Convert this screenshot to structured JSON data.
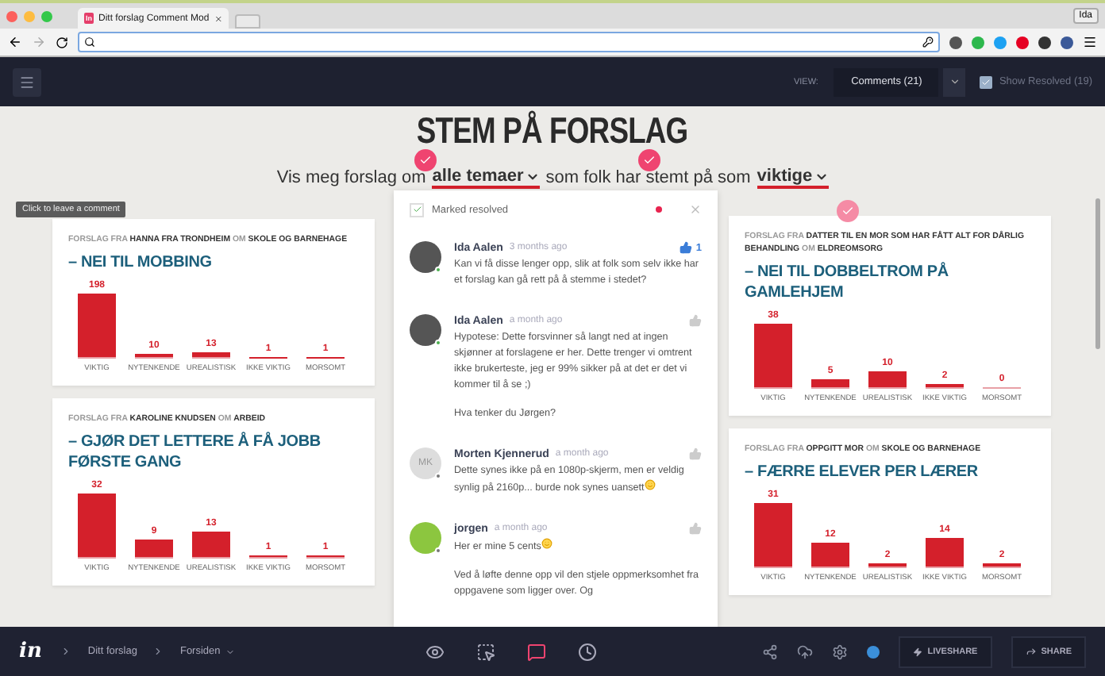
{
  "browser": {
    "tab_title": "Ditt forslag Comment Mod",
    "favicon": "In",
    "profile": "Ida"
  },
  "toolbar": {
    "view_label": "VIEW:",
    "view_value": "Comments (21)",
    "show_resolved": {
      "label": "Show Resolved (19)",
      "checked": true
    }
  },
  "page": {
    "title": "STEM PÅ FORSLAG",
    "filter": [
      {
        "text": "Vis meg forslag om",
        "kind": "plain"
      },
      {
        "text": "alle temaer",
        "kind": "dropdown"
      },
      {
        "text": "som folk har stemt på som",
        "kind": "plain"
      },
      {
        "text": "viktige",
        "kind": "dropdown"
      }
    ]
  },
  "tooltip": "Click to leave a comment",
  "cards": {
    "left": [
      {
        "byline": "FORSLAG FRA **HANNA FRA TRONDHEIM** OM **SKOLE OG BARNEHAGE**",
        "title": "– NEI TIL MOBBING",
        "chart_data": {
          "type": "bar",
          "categories": [
            "VIKTIG",
            "NYTENKENDE",
            "UREALISTISK",
            "IKKE VIKTIG",
            "MORSOMT"
          ],
          "values": [
            198,
            10,
            13,
            1,
            1
          ],
          "data_labels": true,
          "value_labels": [
            "198",
            "10",
            "13",
            "1",
            "1"
          ]
        }
      },
      {
        "byline": "FORSLAG FRA **KAROLINE KNUDSEN** OM **ARBEID**",
        "title": "– GJØR DET LETTERE Å FÅ JOBB FØRSTE GANG",
        "chart_data": {
          "type": "bar",
          "categories": [
            "VIKTIG",
            "NYTENKENDE",
            "UREALISTISK",
            "IKKE VIKTIG",
            "MORSOMT"
          ],
          "values": [
            32,
            9,
            13,
            1,
            1
          ],
          "data_labels": true,
          "value_labels": [
            "32",
            "9",
            "13",
            "1",
            "1"
          ]
        }
      }
    ],
    "right": [
      {
        "byline": "FORSLAG FRA **DATTER TIL EN MOR SOM HAR FÅTT ALT FOR DÅRLIG BEHANDLING** OM **ELDREOMSORG**",
        "title": "– NEI TIL DOBBELTROM PÅ GAMLEHJEM",
        "chart_data": {
          "type": "bar",
          "categories": [
            "VIKTIG",
            "NYTENKENDE",
            "UREALISTISK",
            "IKKE VIKTIG",
            "MORSOMT"
          ],
          "values": [
            38,
            5,
            10,
            2,
            0
          ],
          "data_labels": true,
          "value_labels": [
            "38",
            "5",
            "10",
            "2",
            "0"
          ]
        }
      },
      {
        "byline": "FORSLAG FRA **OPPGITT MOR** OM **SKOLE OG BARNEHAGE**",
        "title": "– FÆRRE ELEVER PER LÆRER",
        "chart_data": {
          "type": "bar",
          "categories": [
            "VIKTIG",
            "NYTENKENDE",
            "UREALISTISK",
            "IKKE VIKTIG",
            "MORSOMT"
          ],
          "values": [
            31,
            12,
            2,
            14,
            2
          ],
          "data_labels": true,
          "value_labels": [
            "31",
            "12",
            "2",
            "14",
            "2"
          ]
        }
      }
    ]
  },
  "comments": {
    "status": "Marked resolved",
    "resolved": true,
    "items": [
      {
        "name": "Ida Aalen",
        "time": "3 months ago",
        "kind": "photo",
        "online": true,
        "liked": true,
        "likes": "1",
        "paragraphs": [
          {
            "text": "Kan vi få disse lenger opp, slik at folk som selv ikke har et forslag kan gå rett på å stemme i stedet?",
            "emoji": false
          }
        ]
      },
      {
        "name": "Ida Aalen",
        "time": "a month ago",
        "kind": "photo",
        "online": true,
        "liked": false,
        "paragraphs": [
          {
            "text": "Hypotese: Dette forsvinner så langt ned at ingen skjønner at forslagene er her. Dette trenger vi omtrent ikke brukerteste, jeg er 99% sikker på at det er det vi kommer til å se ;)",
            "emoji": false
          },
          {
            "text": "Hva tenker du Jørgen?",
            "emoji": false
          }
        ]
      },
      {
        "name": "Morten Kjennerud",
        "time": "a month ago",
        "kind": "initials",
        "initials": "MK",
        "online": false,
        "liked": false,
        "paragraphs": [
          {
            "text": "Dette synes ikke på en 1080p-skjerm, men er veldig synlig på 2160p... burde nok synes uansett",
            "emoji": true
          }
        ]
      },
      {
        "name": "jorgen",
        "time": "a month ago",
        "kind": "illustration",
        "online": false,
        "liked": false,
        "paragraphs": [
          {
            "text": "Her er mine 5 cents",
            "emoji": true
          },
          {
            "text": "Ved å løfte denne opp vil den stjele oppmerksomhet fra oppgavene som ligger over. Og",
            "emoji": false
          }
        ]
      }
    ]
  },
  "bottom_bar": {
    "logo": "in",
    "breadcrumb": [
      "Ditt forslag",
      "Forsiden"
    ],
    "modes": [
      {
        "kind": "preview",
        "selected": false
      },
      {
        "kind": "inspect",
        "selected": false
      },
      {
        "kind": "comment",
        "selected": true
      },
      {
        "kind": "history",
        "selected": false
      }
    ],
    "buttons": [
      {
        "kind": "liveshare",
        "label": "LIVESHARE"
      },
      {
        "kind": "share",
        "label": "SHARE"
      }
    ]
  }
}
